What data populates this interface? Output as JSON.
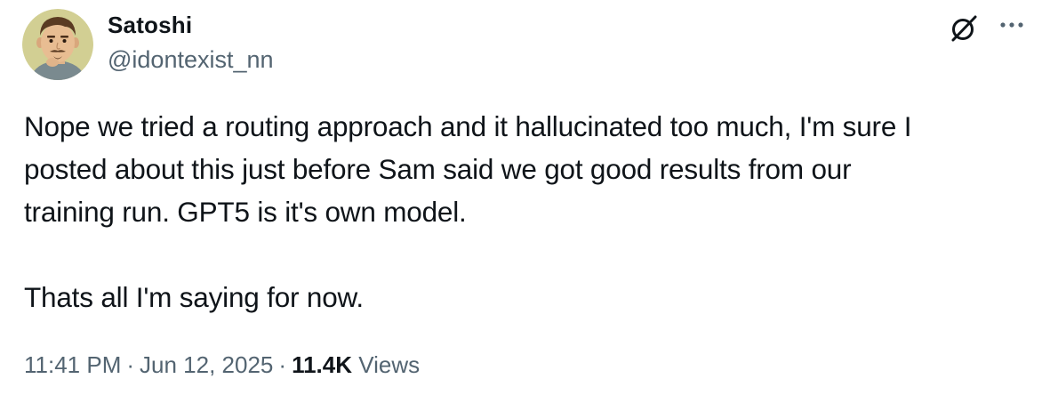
{
  "author": {
    "display_name": "Satoshi",
    "handle": "@idontexist_nn",
    "avatar_icon": "cartoon-avatar-icon"
  },
  "actions": {
    "grok_icon": "grok-icon",
    "more_icon": "more-horizontal-icon"
  },
  "tweet": {
    "lines": [
      "Nope we tried a routing approach and it hallucinated too much, I'm sure I",
      "posted about this just before Sam said we got good results from our",
      "training run.  GPT5 is it's own model.",
      "Thats all I'm saying for now."
    ]
  },
  "meta": {
    "time": "11:41 PM",
    "separator": "·",
    "date": "Jun 12, 2025",
    "views_count": "11.4K",
    "views_label": "Views"
  },
  "colors": {
    "text_primary": "#0f1419",
    "text_secondary": "#536471",
    "background": "#ffffff"
  }
}
